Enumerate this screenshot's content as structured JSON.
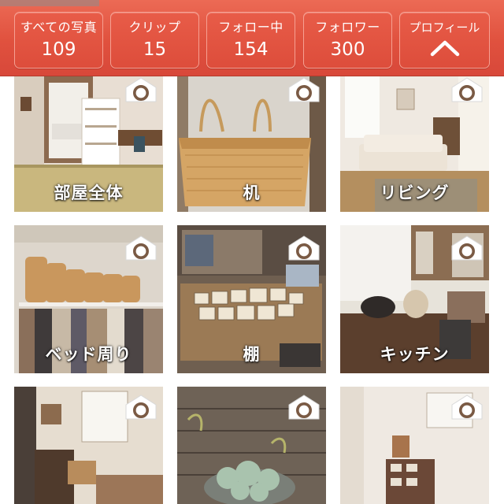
{
  "header": {
    "stats": [
      {
        "label": "すべての写真",
        "value": "109"
      },
      {
        "label": "クリップ",
        "value": "15"
      },
      {
        "label": "フォロー中",
        "value": "154"
      },
      {
        "label": "フォロワー",
        "value": "300"
      }
    ],
    "profile": {
      "label": "プロフィール",
      "icon": "chevron-up-icon"
    }
  },
  "categories": [
    {
      "label": "部屋全体",
      "icon": "room-camera-icon"
    },
    {
      "label": "机",
      "icon": "room-camera-icon"
    },
    {
      "label": "リビング",
      "icon": "room-camera-icon"
    },
    {
      "label": "ベッド周り",
      "icon": "room-camera-icon"
    },
    {
      "label": "棚",
      "icon": "room-camera-icon"
    },
    {
      "label": "キッチン",
      "icon": "room-camera-icon"
    },
    {
      "label": "",
      "icon": "room-camera-icon"
    },
    {
      "label": "",
      "icon": "room-camera-icon"
    },
    {
      "label": "",
      "icon": "room-camera-icon"
    }
  ],
  "colors": {
    "header": "#e0513e",
    "button_border": "#f6a092",
    "text": "#ffffff"
  }
}
